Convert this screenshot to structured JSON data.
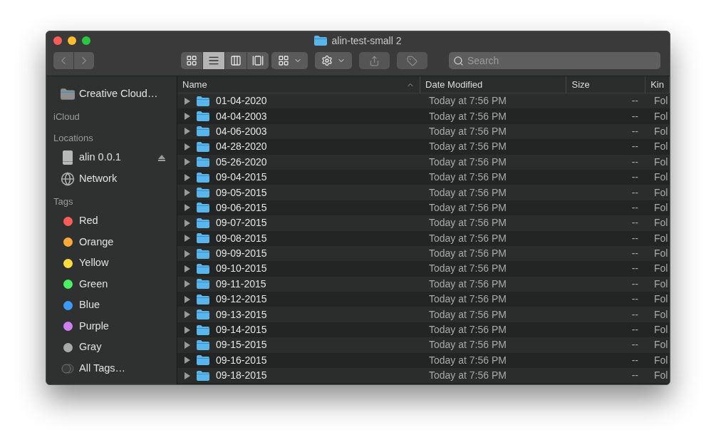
{
  "window": {
    "title": "alin-test-small 2"
  },
  "toolbar": {
    "navigation": [
      {
        "kind": "back",
        "disabled": true
      },
      {
        "kind": "forward",
        "disabled": true
      }
    ],
    "view_modes": [
      {
        "kind": "icons",
        "selected": false
      },
      {
        "kind": "list",
        "selected": true
      },
      {
        "kind": "columns",
        "selected": false
      },
      {
        "kind": "gallery",
        "selected": false
      }
    ],
    "search": {
      "placeholder": "Search"
    }
  },
  "sidebar": {
    "sections": [
      {
        "items": [
          {
            "label": "Creative Cloud…",
            "kind": "folder"
          }
        ]
      },
      {
        "heading": "iCloud"
      },
      {
        "heading": "Locations",
        "items": [
          {
            "label": "alin 0.0.1",
            "kind": "drive",
            "ejectable": true
          },
          {
            "label": "Network",
            "kind": "network",
            "ejectable": false
          }
        ]
      },
      {
        "heading": "Tags",
        "items": [
          {
            "label": "Red",
            "kind": "tag",
            "color": "#fc5d57"
          },
          {
            "label": "Orange",
            "kind": "tag",
            "color": "#fda93a"
          },
          {
            "label": "Yellow",
            "kind": "tag",
            "color": "#fedc3f"
          },
          {
            "label": "Green",
            "kind": "tag",
            "color": "#4cf063"
          },
          {
            "label": "Blue",
            "kind": "tag",
            "color": "#3d99fc"
          },
          {
            "label": "Purple",
            "kind": "tag",
            "color": "#d07ef1"
          },
          {
            "label": "Gray",
            "kind": "tag",
            "color": "#a9a9ab"
          },
          {
            "label": "All Tags…",
            "kind": "all-tags"
          }
        ]
      }
    ]
  },
  "table": {
    "columns": [
      {
        "label": "Name",
        "sorted": true
      },
      {
        "label": "Date Modified",
        "sorted": false
      },
      {
        "label": "Size",
        "sorted": false
      },
      {
        "label": "Kin",
        "sorted": false
      }
    ],
    "rows": [
      {
        "name": "01-04-2020",
        "date": "Today at 7:56 PM",
        "size": "--",
        "kind": "Fol"
      },
      {
        "name": "04-04-2003",
        "date": "Today at 7:56 PM",
        "size": "--",
        "kind": "Fol"
      },
      {
        "name": "04-06-2003",
        "date": "Today at 7:56 PM",
        "size": "--",
        "kind": "Fol"
      },
      {
        "name": "04-28-2020",
        "date": "Today at 7:56 PM",
        "size": "--",
        "kind": "Fol"
      },
      {
        "name": "05-26-2020",
        "date": "Today at 7:56 PM",
        "size": "--",
        "kind": "Fol"
      },
      {
        "name": "09-04-2015",
        "date": "Today at 7:56 PM",
        "size": "--",
        "kind": "Fol"
      },
      {
        "name": "09-05-2015",
        "date": "Today at 7:56 PM",
        "size": "--",
        "kind": "Fol"
      },
      {
        "name": "09-06-2015",
        "date": "Today at 7:56 PM",
        "size": "--",
        "kind": "Fol"
      },
      {
        "name": "09-07-2015",
        "date": "Today at 7:56 PM",
        "size": "--",
        "kind": "Fol"
      },
      {
        "name": "09-08-2015",
        "date": "Today at 7:56 PM",
        "size": "--",
        "kind": "Fol"
      },
      {
        "name": "09-09-2015",
        "date": "Today at 7:56 PM",
        "size": "--",
        "kind": "Fol"
      },
      {
        "name": "09-10-2015",
        "date": "Today at 7:56 PM",
        "size": "--",
        "kind": "Fol"
      },
      {
        "name": "09-11-2015",
        "date": "Today at 7:56 PM",
        "size": "--",
        "kind": "Fol"
      },
      {
        "name": "09-12-2015",
        "date": "Today at 7:56 PM",
        "size": "--",
        "kind": "Fol"
      },
      {
        "name": "09-13-2015",
        "date": "Today at 7:56 PM",
        "size": "--",
        "kind": "Fol"
      },
      {
        "name": "09-14-2015",
        "date": "Today at 7:56 PM",
        "size": "--",
        "kind": "Fol"
      },
      {
        "name": "09-15-2015",
        "date": "Today at 7:56 PM",
        "size": "--",
        "kind": "Fol"
      },
      {
        "name": "09-16-2015",
        "date": "Today at 7:56 PM",
        "size": "--",
        "kind": "Fol"
      },
      {
        "name": "09-18-2015",
        "date": "Today at 7:56 PM",
        "size": "--",
        "kind": "Fol"
      }
    ]
  }
}
